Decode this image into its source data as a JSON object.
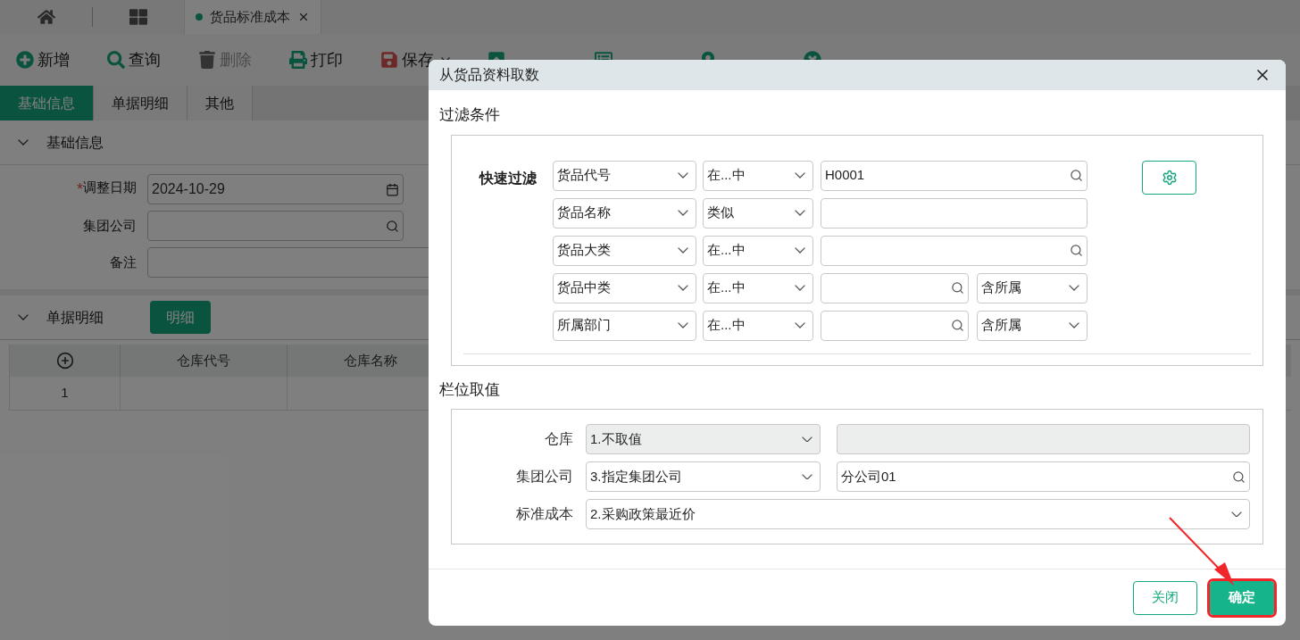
{
  "open_tabs": [
    {
      "label": "货品标准成本",
      "selected": true
    }
  ],
  "toolbar": [
    {
      "label": "新增",
      "kind": "add",
      "disabled": false,
      "dropdown": false
    },
    {
      "label": "查询",
      "kind": "search",
      "disabled": false,
      "dropdown": false
    },
    {
      "label": "删除",
      "kind": "delete",
      "disabled": true,
      "dropdown": false
    },
    {
      "label": "打印",
      "kind": "print",
      "disabled": false,
      "dropdown": false
    },
    {
      "label": "保存",
      "kind": "save",
      "disabled": false,
      "dropdown": true
    },
    {
      "kind": "submit"
    },
    {
      "kind": "related"
    },
    {
      "kind": "fetch"
    },
    {
      "kind": "close"
    }
  ],
  "form_tabs": [
    {
      "label": "基础信息",
      "selected": true
    },
    {
      "label": "单据明细",
      "selected": false
    },
    {
      "label": "其他",
      "selected": false
    }
  ],
  "basic_section": {
    "title": "基础信息",
    "expanded": true,
    "fields": [
      {
        "label": "调整日期",
        "required_mark": "*",
        "value": "2024-10-29",
        "kind": "date"
      },
      {
        "label": "集团公司",
        "kind": "lookup"
      },
      {
        "label": "备注",
        "kind": "text"
      }
    ]
  },
  "detail_section": {
    "title": "单据明细",
    "expanded": true,
    "button": "明细",
    "table": {
      "columns": [
        "仓库代号",
        "仓库名称"
      ],
      "rows": [
        {
          "index": "1"
        }
      ]
    }
  },
  "dialog": {
    "title": "从货品资料取数",
    "filter": {
      "title": "过滤条件",
      "label": "快速过滤",
      "rows": [
        {
          "field": "货品代号",
          "operator": "在...中",
          "value": "H0001",
          "kind": "lookup"
        },
        {
          "field": "货品名称",
          "operator": "类似",
          "kind": "text"
        },
        {
          "field": "货品大类",
          "operator": "在...中",
          "kind": "lookup"
        },
        {
          "field": "货品中类",
          "operator": "在...中",
          "kind": "lookup_scope",
          "scope": "含所属"
        },
        {
          "field": "所属部门",
          "operator": "在...中",
          "kind": "lookup_scope",
          "scope": "含所属"
        }
      ]
    },
    "values": {
      "title": "栏位取值",
      "rows": [
        {
          "label": "仓库",
          "option": "1.不取值",
          "disabled": true,
          "kind": "with_value"
        },
        {
          "label": "集团公司",
          "option": "3.指定集团公司",
          "value": "分公司01",
          "disabled": false,
          "kind": "with_lookup"
        },
        {
          "label": "标准成本",
          "option": "2.采购政策最近价",
          "disabled": false,
          "kind": "full"
        }
      ]
    },
    "buttons": [
      {
        "label": "关闭",
        "kind": "secondary",
        "highlighted": false
      },
      {
        "label": "确定",
        "kind": "primary",
        "highlighted": true
      }
    ]
  }
}
